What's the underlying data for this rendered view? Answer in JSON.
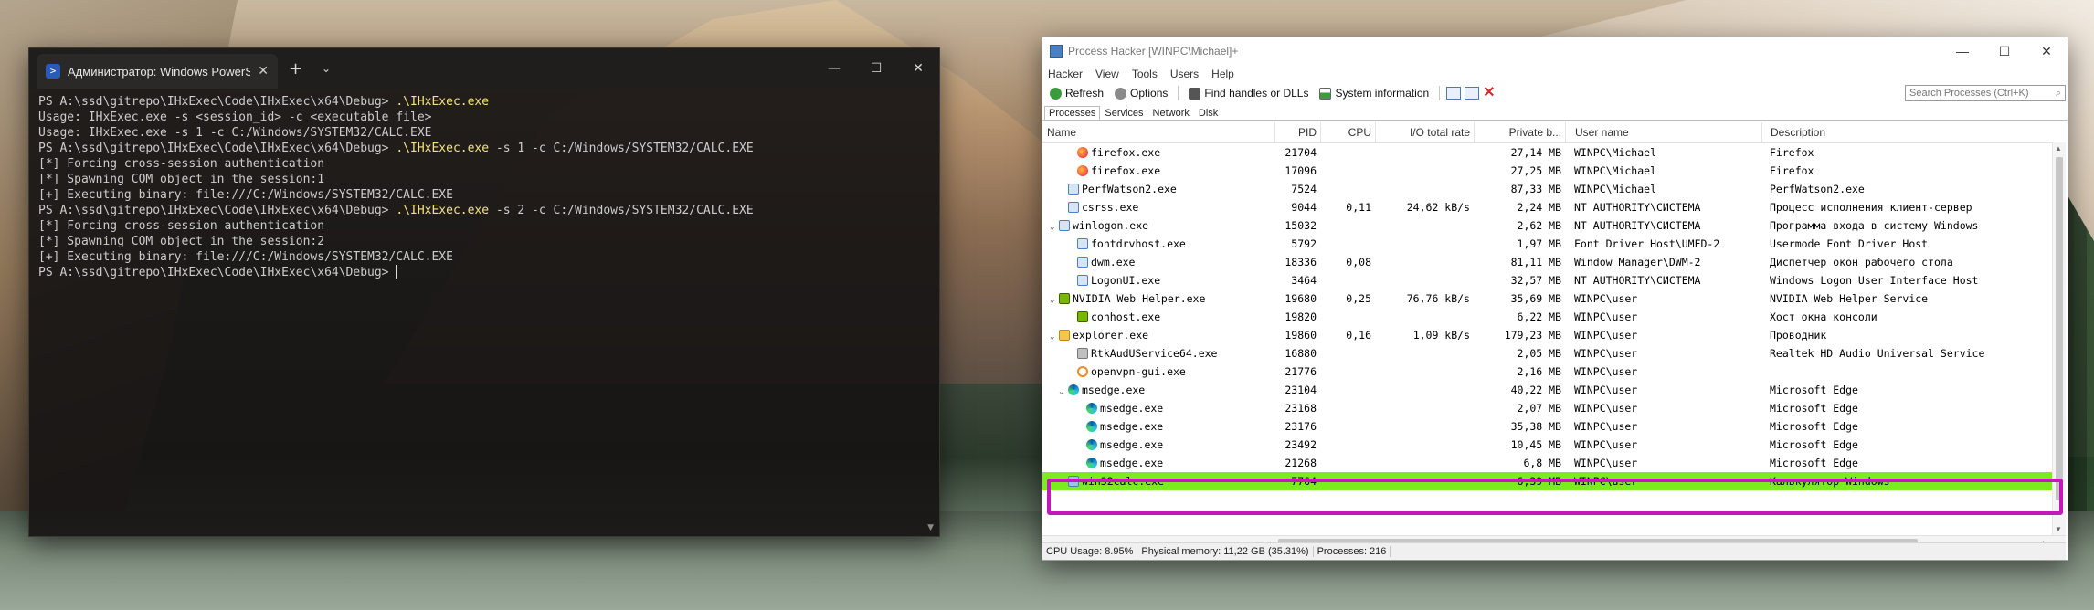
{
  "terminal": {
    "tab_title": "Администратор: Windows PowerShell",
    "new_tab": "+",
    "dropdown": "⌄",
    "controls": {
      "minimize": "—",
      "maximize": "☐",
      "close": "✕"
    },
    "lines": [
      {
        "prefix": "PS A:\\ssd\\gitrepo\\IHxExec\\Code\\IHxExec\\x64\\Debug> ",
        "cmd": ".\\IHxExec.exe",
        "args": ""
      },
      {
        "plain": "Usage: IHxExec.exe -s <session_id> -c <executable file>"
      },
      {
        "plain": "Usage: IHxExec.exe -s 1 -c C:/Windows/SYSTEM32/CALC.EXE"
      },
      {
        "prefix": "PS A:\\ssd\\gitrepo\\IHxExec\\Code\\IHxExec\\x64\\Debug> ",
        "cmd": ".\\IHxExec.exe",
        "args": " -s 1 -c C:/Windows/SYSTEM32/CALC.EXE"
      },
      {
        "plain": "[*] Forcing cross-session authentication"
      },
      {
        "plain": "[*] Spawning COM object in the session:1"
      },
      {
        "plain": "[+] Executing binary: file:///C:/Windows/SYSTEM32/CALC.EXE"
      },
      {
        "prefix": "PS A:\\ssd\\gitrepo\\IHxExec\\Code\\IHxExec\\x64\\Debug> ",
        "cmd": ".\\IHxExec.exe",
        "args": " -s 2 -c C:/Windows/SYSTEM32/CALC.EXE"
      },
      {
        "plain": "[*] Forcing cross-session authentication"
      },
      {
        "plain": "[*] Spawning COM object in the session:2"
      },
      {
        "plain": "[+] Executing binary: file:///C:/Windows/SYSTEM32/CALC.EXE"
      },
      {
        "prefix": "PS A:\\ssd\\gitrepo\\IHxExec\\Code\\IHxExec\\x64\\Debug> ",
        "cmd": "",
        "args": "",
        "cursor": true
      }
    ]
  },
  "process_hacker": {
    "title": "Process Hacker [WINPC\\Michael]+",
    "controls": {
      "minimize": "—",
      "maximize": "☐",
      "close": "✕"
    },
    "menu": [
      "Hacker",
      "View",
      "Tools",
      "Users",
      "Help"
    ],
    "toolbar": {
      "refresh": "Refresh",
      "options": "Options",
      "find_handles": "Find handles or DLLs",
      "system_info": "System information",
      "search_placeholder": "Search Processes (Ctrl+K)"
    },
    "tabs": [
      "Processes",
      "Services",
      "Network",
      "Disk"
    ],
    "columns": {
      "name": "Name",
      "pid": "PID",
      "cpu": "CPU",
      "io": "I/O total rate",
      "private": "Private b...",
      "user": "User name",
      "desc": "Description"
    },
    "rows": [
      {
        "indent": 2,
        "exp": "",
        "icon": "ff",
        "name": "firefox.exe",
        "pid": "21704",
        "cpu": "",
        "io": "",
        "priv": "27,14 MB",
        "user": "WINPC\\Michael",
        "desc": "Firefox"
      },
      {
        "indent": 2,
        "exp": "",
        "icon": "ff",
        "name": "firefox.exe",
        "pid": "17096",
        "cpu": "",
        "io": "",
        "priv": "27,25 MB",
        "user": "WINPC\\Michael",
        "desc": "Firefox"
      },
      {
        "indent": 1,
        "exp": "",
        "icon": "svc",
        "name": "PerfWatson2.exe",
        "pid": "7524",
        "cpu": "",
        "io": "",
        "priv": "87,33 MB",
        "user": "WINPC\\Michael",
        "desc": "PerfWatson2.exe"
      },
      {
        "indent": 1,
        "exp": "",
        "icon": "svc",
        "name": "csrss.exe",
        "pid": "9044",
        "cpu": "0,11",
        "io": "24,62 kB/s",
        "priv": "2,24 MB",
        "user": "NT AUTHORITY\\СИСТЕМА",
        "desc": "Процесс исполнения клиент-сервер"
      },
      {
        "indent": 0,
        "exp": "⌄",
        "icon": "svc",
        "name": "winlogon.exe",
        "pid": "15032",
        "cpu": "",
        "io": "",
        "priv": "2,62 MB",
        "user": "NT AUTHORITY\\СИСТЕМА",
        "desc": "Программа входа в систему Windows"
      },
      {
        "indent": 2,
        "exp": "",
        "icon": "svc",
        "name": "fontdrvhost.exe",
        "pid": "5792",
        "cpu": "",
        "io": "",
        "priv": "1,97 MB",
        "user": "Font Driver Host\\UMFD-2",
        "desc": "Usermode Font Driver Host"
      },
      {
        "indent": 2,
        "exp": "",
        "icon": "svc",
        "name": "dwm.exe",
        "pid": "18336",
        "cpu": "0,08",
        "io": "",
        "priv": "81,11 MB",
        "user": "Window Manager\\DWM-2",
        "desc": "Диспетчер окон рабочего стола"
      },
      {
        "indent": 2,
        "exp": "",
        "icon": "svc",
        "name": "LogonUI.exe",
        "pid": "3464",
        "cpu": "",
        "io": "",
        "priv": "32,57 MB",
        "user": "NT AUTHORITY\\СИСТЕМА",
        "desc": "Windows Logon User Interface Host"
      },
      {
        "indent": 0,
        "exp": "⌄",
        "icon": "nv",
        "name": "NVIDIA Web Helper.exe",
        "pid": "19680",
        "cpu": "0,25",
        "io": "76,76 kB/s",
        "priv": "35,69 MB",
        "user": "WINPC\\user",
        "desc": "NVIDIA Web Helper Service"
      },
      {
        "indent": 2,
        "exp": "",
        "icon": "nv",
        "name": "conhost.exe",
        "pid": "19820",
        "cpu": "",
        "io": "",
        "priv": "6,22 MB",
        "user": "WINPC\\user",
        "desc": "Хост окна консоли"
      },
      {
        "indent": 0,
        "exp": "⌄",
        "icon": "ex",
        "name": "explorer.exe",
        "pid": "19860",
        "cpu": "0,16",
        "io": "1,09 kB/s",
        "priv": "179,23 MB",
        "user": "WINPC\\user",
        "desc": "Проводник"
      },
      {
        "indent": 2,
        "exp": "",
        "icon": "rt",
        "name": "RtkAudUService64.exe",
        "pid": "16880",
        "cpu": "",
        "io": "",
        "priv": "2,05 MB",
        "user": "WINPC\\user",
        "desc": "Realtek HD Audio Universal Service"
      },
      {
        "indent": 2,
        "exp": "",
        "icon": "ov",
        "name": "openvpn-gui.exe",
        "pid": "21776",
        "cpu": "",
        "io": "",
        "priv": "2,16 MB",
        "user": "WINPC\\user",
        "desc": ""
      },
      {
        "indent": 1,
        "exp": "⌄",
        "icon": "me",
        "name": "msedge.exe",
        "pid": "23104",
        "cpu": "",
        "io": "",
        "priv": "40,22 MB",
        "user": "WINPC\\user",
        "desc": "Microsoft Edge"
      },
      {
        "indent": 3,
        "exp": "",
        "icon": "me",
        "name": "msedge.exe",
        "pid": "23168",
        "cpu": "",
        "io": "",
        "priv": "2,07 MB",
        "user": "WINPC\\user",
        "desc": "Microsoft Edge"
      },
      {
        "indent": 3,
        "exp": "",
        "icon": "me",
        "name": "msedge.exe",
        "pid": "23176",
        "cpu": "",
        "io": "",
        "priv": "35,38 MB",
        "user": "WINPC\\user",
        "desc": "Microsoft Edge"
      },
      {
        "indent": 3,
        "exp": "",
        "icon": "me",
        "name": "msedge.exe",
        "pid": "23492",
        "cpu": "",
        "io": "",
        "priv": "10,45 MB",
        "user": "WINPC\\user",
        "desc": "Microsoft Edge"
      },
      {
        "indent": 3,
        "exp": "",
        "icon": "me",
        "name": "msedge.exe",
        "pid": "21268",
        "cpu": "",
        "io": "",
        "priv": "6,8 MB",
        "user": "WINPC\\user",
        "desc": "Microsoft Edge"
      },
      {
        "indent": 1,
        "exp": "",
        "icon": "wc",
        "name": "win32calc.exe",
        "pid": "7764",
        "cpu": "",
        "io": "",
        "priv": "6,39 MB",
        "user": "WINPC\\user",
        "desc": "Калькулятор Windows",
        "selected": true
      }
    ],
    "status": {
      "cpu": "CPU Usage: 8.95%",
      "memory": "Physical memory: 11,22 GB (35.31%)",
      "processes": "Processes: 216"
    },
    "scroll": {
      "left": "‹",
      "right": "›"
    }
  },
  "colors": {
    "selected_row": "#7bed1f",
    "highlight_box": "#c418b9",
    "terminal_accent": "#f2e380"
  }
}
